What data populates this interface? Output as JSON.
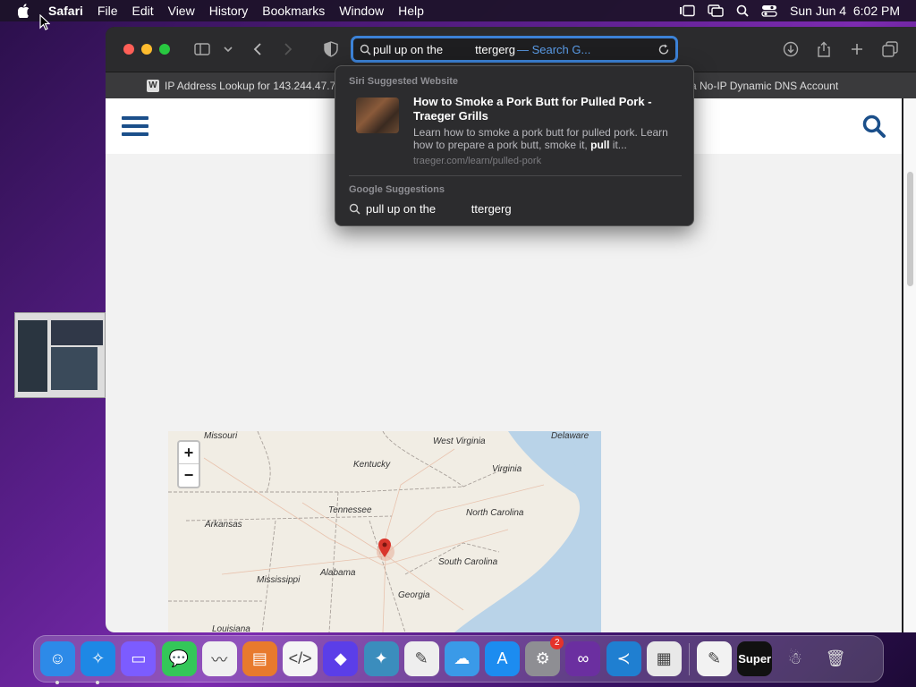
{
  "menubar": {
    "app": "Safari",
    "items": [
      "File",
      "Edit",
      "View",
      "History",
      "Bookmarks",
      "Window",
      "Help"
    ],
    "datetime": "Sun Jun 4  6:02 PM"
  },
  "toolbar": {
    "address_query": "pull up on the          ttergerg",
    "address_suffix": "— Search G..."
  },
  "tabs": {
    "active": "IP Address Lookup for 143.244.47.73",
    "other": "a No-IP Dynamic DNS Account"
  },
  "dropdown": {
    "siri_header": "Siri Suggested Website",
    "result_title": "How to Smoke a Pork Butt for Pulled Pork - Traeger Grills",
    "result_desc_1": "Learn how to smoke a pork butt for pulled pork. Learn how to prepare a pork butt, smoke it, ",
    "result_desc_bold": "pull",
    "result_desc_2": " it...",
    "result_url": "traeger.com/learn/pulled-pork",
    "google_header": "Google Suggestions",
    "google_suggestion": "pull up on the           ttergerg"
  },
  "map": {
    "zoom_in": "+",
    "zoom_out": "−",
    "labels": [
      {
        "text": "Missouri"
      },
      {
        "text": "Kentucky"
      },
      {
        "text": "West Virginia"
      },
      {
        "text": "Delaware"
      },
      {
        "text": "Virginia"
      },
      {
        "text": "Tennessee"
      },
      {
        "text": "Arkansas"
      },
      {
        "text": "North Carolina"
      },
      {
        "text": "South Carolina"
      },
      {
        "text": "Alabama"
      },
      {
        "text": "Mississippi"
      },
      {
        "text": "Georgia"
      },
      {
        "text": "Louisiana"
      }
    ]
  },
  "dock": {
    "apps": [
      {
        "name": "Finder",
        "color": "#2d8ae8",
        "icon": "finder-icon",
        "dot": true
      },
      {
        "name": "Safari",
        "color": "#1e88e5",
        "icon": "safari-icon",
        "dot": true
      },
      {
        "name": "Podcasts-like",
        "color": "#7c5cff",
        "icon": "laptop-icon",
        "dot": false
      },
      {
        "name": "Messages",
        "color": "#34c759",
        "icon": "messages-icon",
        "dot": false
      },
      {
        "name": "Freeform",
        "color": "#f0f0f0",
        "icon": "freeform-icon",
        "dot": false
      },
      {
        "name": "Keynote",
        "color": "#e87a2d",
        "icon": "keynote-icon",
        "dot": false
      },
      {
        "name": "Script Editor",
        "color": "#f5f5f5",
        "icon": "code-icon",
        "dot": false
      },
      {
        "name": "Shortcuts",
        "color": "#5b3ee8",
        "icon": "shortcuts-icon",
        "dot": false
      },
      {
        "name": "Tools",
        "color": "#3b8dbd",
        "icon": "tools-icon",
        "dot": false
      },
      {
        "name": "Sketch",
        "color": "#eeeeee",
        "icon": "pen-icon",
        "dot": false
      },
      {
        "name": "Weather",
        "color": "#3a9ae8",
        "icon": "weather-icon",
        "dot": false
      },
      {
        "name": "App Store",
        "color": "#1c8cf0",
        "icon": "appstore-icon",
        "dot": false
      },
      {
        "name": "System Settings",
        "color": "#8e8e93",
        "icon": "settings-icon",
        "dot": false,
        "badge": "2"
      },
      {
        "name": "Visual Studio",
        "color": "#6b2fa0",
        "icon": "vs-icon",
        "dot": false
      },
      {
        "name": "VS Code",
        "color": "#1f7fd1",
        "icon": "vscode-icon",
        "dot": false
      },
      {
        "name": "Launchpad",
        "color": "#e8e8e8",
        "icon": "launchpad-icon",
        "dot": false
      }
    ],
    "after": [
      {
        "name": "TextEdit",
        "color": "#f2f2f2",
        "icon": "textedit-icon"
      },
      {
        "name": "Super",
        "color": "#111",
        "icon": "super-icon",
        "label": "Super"
      },
      {
        "name": "Character",
        "color": "transparent",
        "icon": "character-icon"
      },
      {
        "name": "Trash",
        "color": "transparent",
        "icon": "trash-icon"
      }
    ]
  }
}
